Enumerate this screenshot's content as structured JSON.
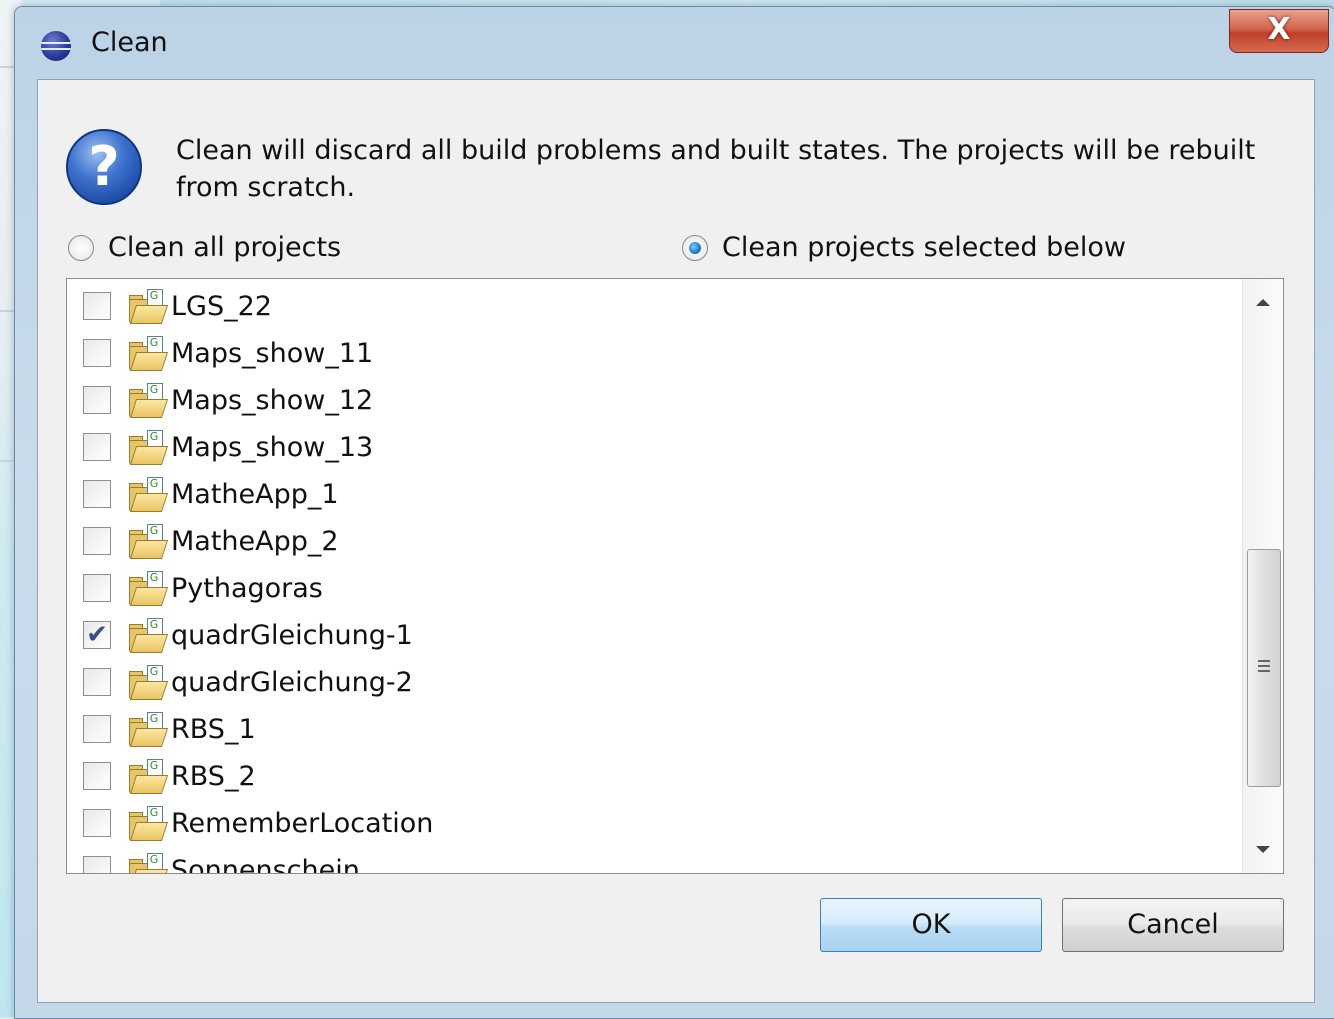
{
  "dialog": {
    "title": "Clean",
    "close_label": "X",
    "message": "Clean will discard all build problems and built states.  The projects will be rebuilt from scratch.",
    "radio_all": {
      "label": "Clean all projects",
      "checked": false
    },
    "radio_selected": {
      "label": "Clean projects selected below",
      "checked": true
    },
    "projects": [
      {
        "name": "LGS_22",
        "checked": false
      },
      {
        "name": "Maps_show_11",
        "checked": false
      },
      {
        "name": "Maps_show_12",
        "checked": false
      },
      {
        "name": "Maps_show_13",
        "checked": false
      },
      {
        "name": "MatheApp_1",
        "checked": false
      },
      {
        "name": "MatheApp_2",
        "checked": false
      },
      {
        "name": "Pythagoras",
        "checked": false
      },
      {
        "name": "quadrGleichung-1",
        "checked": true
      },
      {
        "name": "quadrGleichung-2",
        "checked": false
      },
      {
        "name": "RBS_1",
        "checked": false
      },
      {
        "name": "RBS_2",
        "checked": false
      },
      {
        "name": "RememberLocation",
        "checked": false
      },
      {
        "name": "Sonnenschein",
        "checked": false
      }
    ],
    "buttons": {
      "ok": "OK",
      "cancel": "Cancel"
    }
  }
}
